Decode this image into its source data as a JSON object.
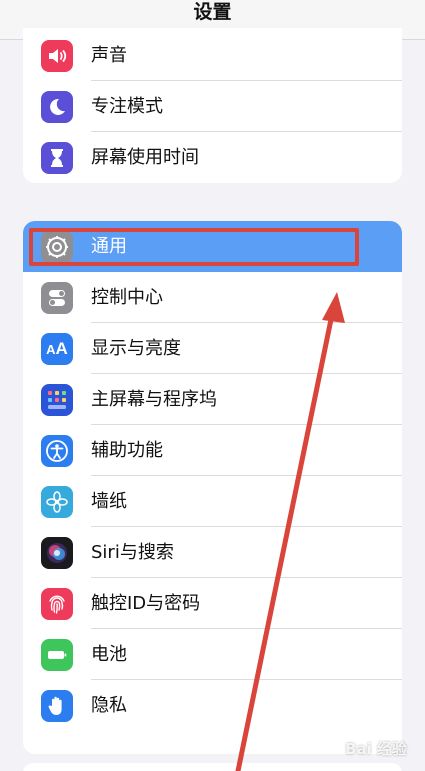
{
  "header": {
    "title": "设置"
  },
  "group1": {
    "items": [
      {
        "label": "声音",
        "icon": "speaker-icon",
        "color": "#ef3b5b"
      },
      {
        "label": "专注模式",
        "icon": "moon-icon",
        "color": "#5a4fd6"
      },
      {
        "label": "屏幕使用时间",
        "icon": "hourglass-icon",
        "color": "#5a4fd6"
      }
    ]
  },
  "group2": {
    "items": [
      {
        "label": "通用",
        "icon": "gear-icon",
        "color": "#8e8e93",
        "selected": true
      },
      {
        "label": "控制中心",
        "icon": "toggles-icon",
        "color": "#8e8e93"
      },
      {
        "label": "显示与亮度",
        "icon": "text-size-icon",
        "color": "#2c7ef0"
      },
      {
        "label": "主屏幕与程序坞",
        "icon": "home-grid-icon",
        "color": "#2c54d6"
      },
      {
        "label": "辅助功能",
        "icon": "accessibility-icon",
        "color": "#2c7ef0"
      },
      {
        "label": "墙纸",
        "icon": "flower-icon",
        "color": "#36aadc"
      },
      {
        "label": "Siri与搜索",
        "icon": "siri-icon",
        "color": "#1b1b1f"
      },
      {
        "label": "触控ID与密码",
        "icon": "fingerprint-icon",
        "color": "#ef3b5b"
      },
      {
        "label": "电池",
        "icon": "battery-icon",
        "color": "#3ec55b"
      },
      {
        "label": "隐私",
        "icon": "hand-icon",
        "color": "#2c7ef0"
      }
    ]
  },
  "annotation": {
    "box_color": "#d9453a",
    "arrow_color": "#d9453a"
  },
  "watermark": {
    "text": "Bai 经验"
  }
}
